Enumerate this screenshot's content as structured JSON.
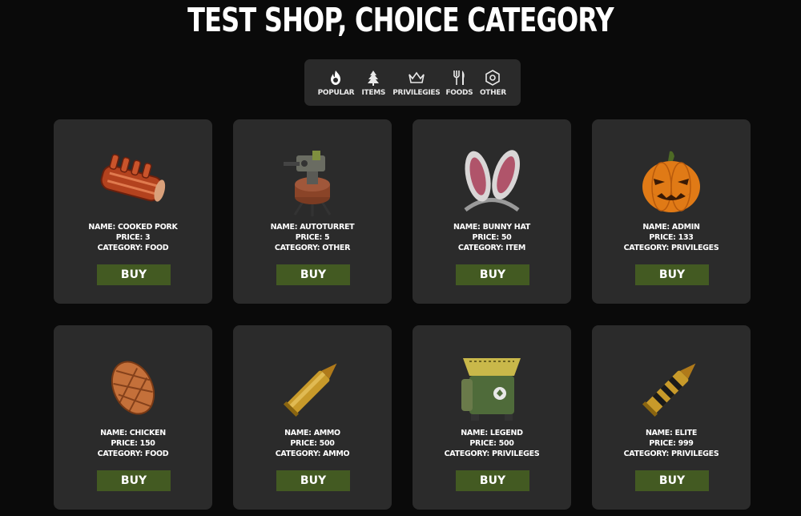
{
  "title": "TEST SHOP, CHOICE CATEGORY",
  "categories": [
    {
      "label": "POPULAR",
      "icon": "flame-icon"
    },
    {
      "label": "ITEMS",
      "icon": "tree-icon"
    },
    {
      "label": "PRIVILEGIES",
      "icon": "crown-icon"
    },
    {
      "label": "FOODS",
      "icon": "fork-knife-icon"
    },
    {
      "label": "OTHER",
      "icon": "hexagon-nut-icon"
    }
  ],
  "products": [
    {
      "name_line": "NAME: COOKED PORK",
      "price_line": "PRICE: 3",
      "category_line": "CATEGORY: FOOD",
      "buy": "BUY",
      "image": "cooked-pork"
    },
    {
      "name_line": "NAME: AUTOTURRET",
      "price_line": "PRICE: 5",
      "category_line": "CATEGORY: OTHER",
      "buy": "BUY",
      "image": "autoturret"
    },
    {
      "name_line": "NAME: BUNNY HAT",
      "price_line": "PRICE: 50",
      "category_line": "CATEGORY: ITEM",
      "buy": "BUY",
      "image": "bunny-hat"
    },
    {
      "name_line": "NAME: ADMIN",
      "price_line": "PRICE: 133",
      "category_line": "CATEGORY: PRIVILEGES",
      "buy": "BUY",
      "image": "pumpkin"
    },
    {
      "name_line": "NAME: CHICKEN",
      "price_line": "PRICE: 150",
      "category_line": "CATEGORY: FOOD",
      "buy": "BUY",
      "image": "chicken"
    },
    {
      "name_line": "NAME: AMMO",
      "price_line": "PRICE: 500",
      "category_line": "CATEGORY: AMMO",
      "buy": "BUY",
      "image": "ammo"
    },
    {
      "name_line": "NAME: LEGEND",
      "price_line": "PRICE: 500",
      "category_line": "CATEGORY: PRIVILEGES",
      "buy": "BUY",
      "image": "recycler"
    },
    {
      "name_line": "NAME: ELITE",
      "price_line": "PRICE: 999",
      "category_line": "CATEGORY: PRIVILEGES",
      "buy": "BUY",
      "image": "striped-ammo"
    }
  ],
  "colors": {
    "background": "#0a0a0a",
    "card": "#2b2b2b",
    "buy_button": "#435a22",
    "category_bar": "#2a2a2a"
  }
}
